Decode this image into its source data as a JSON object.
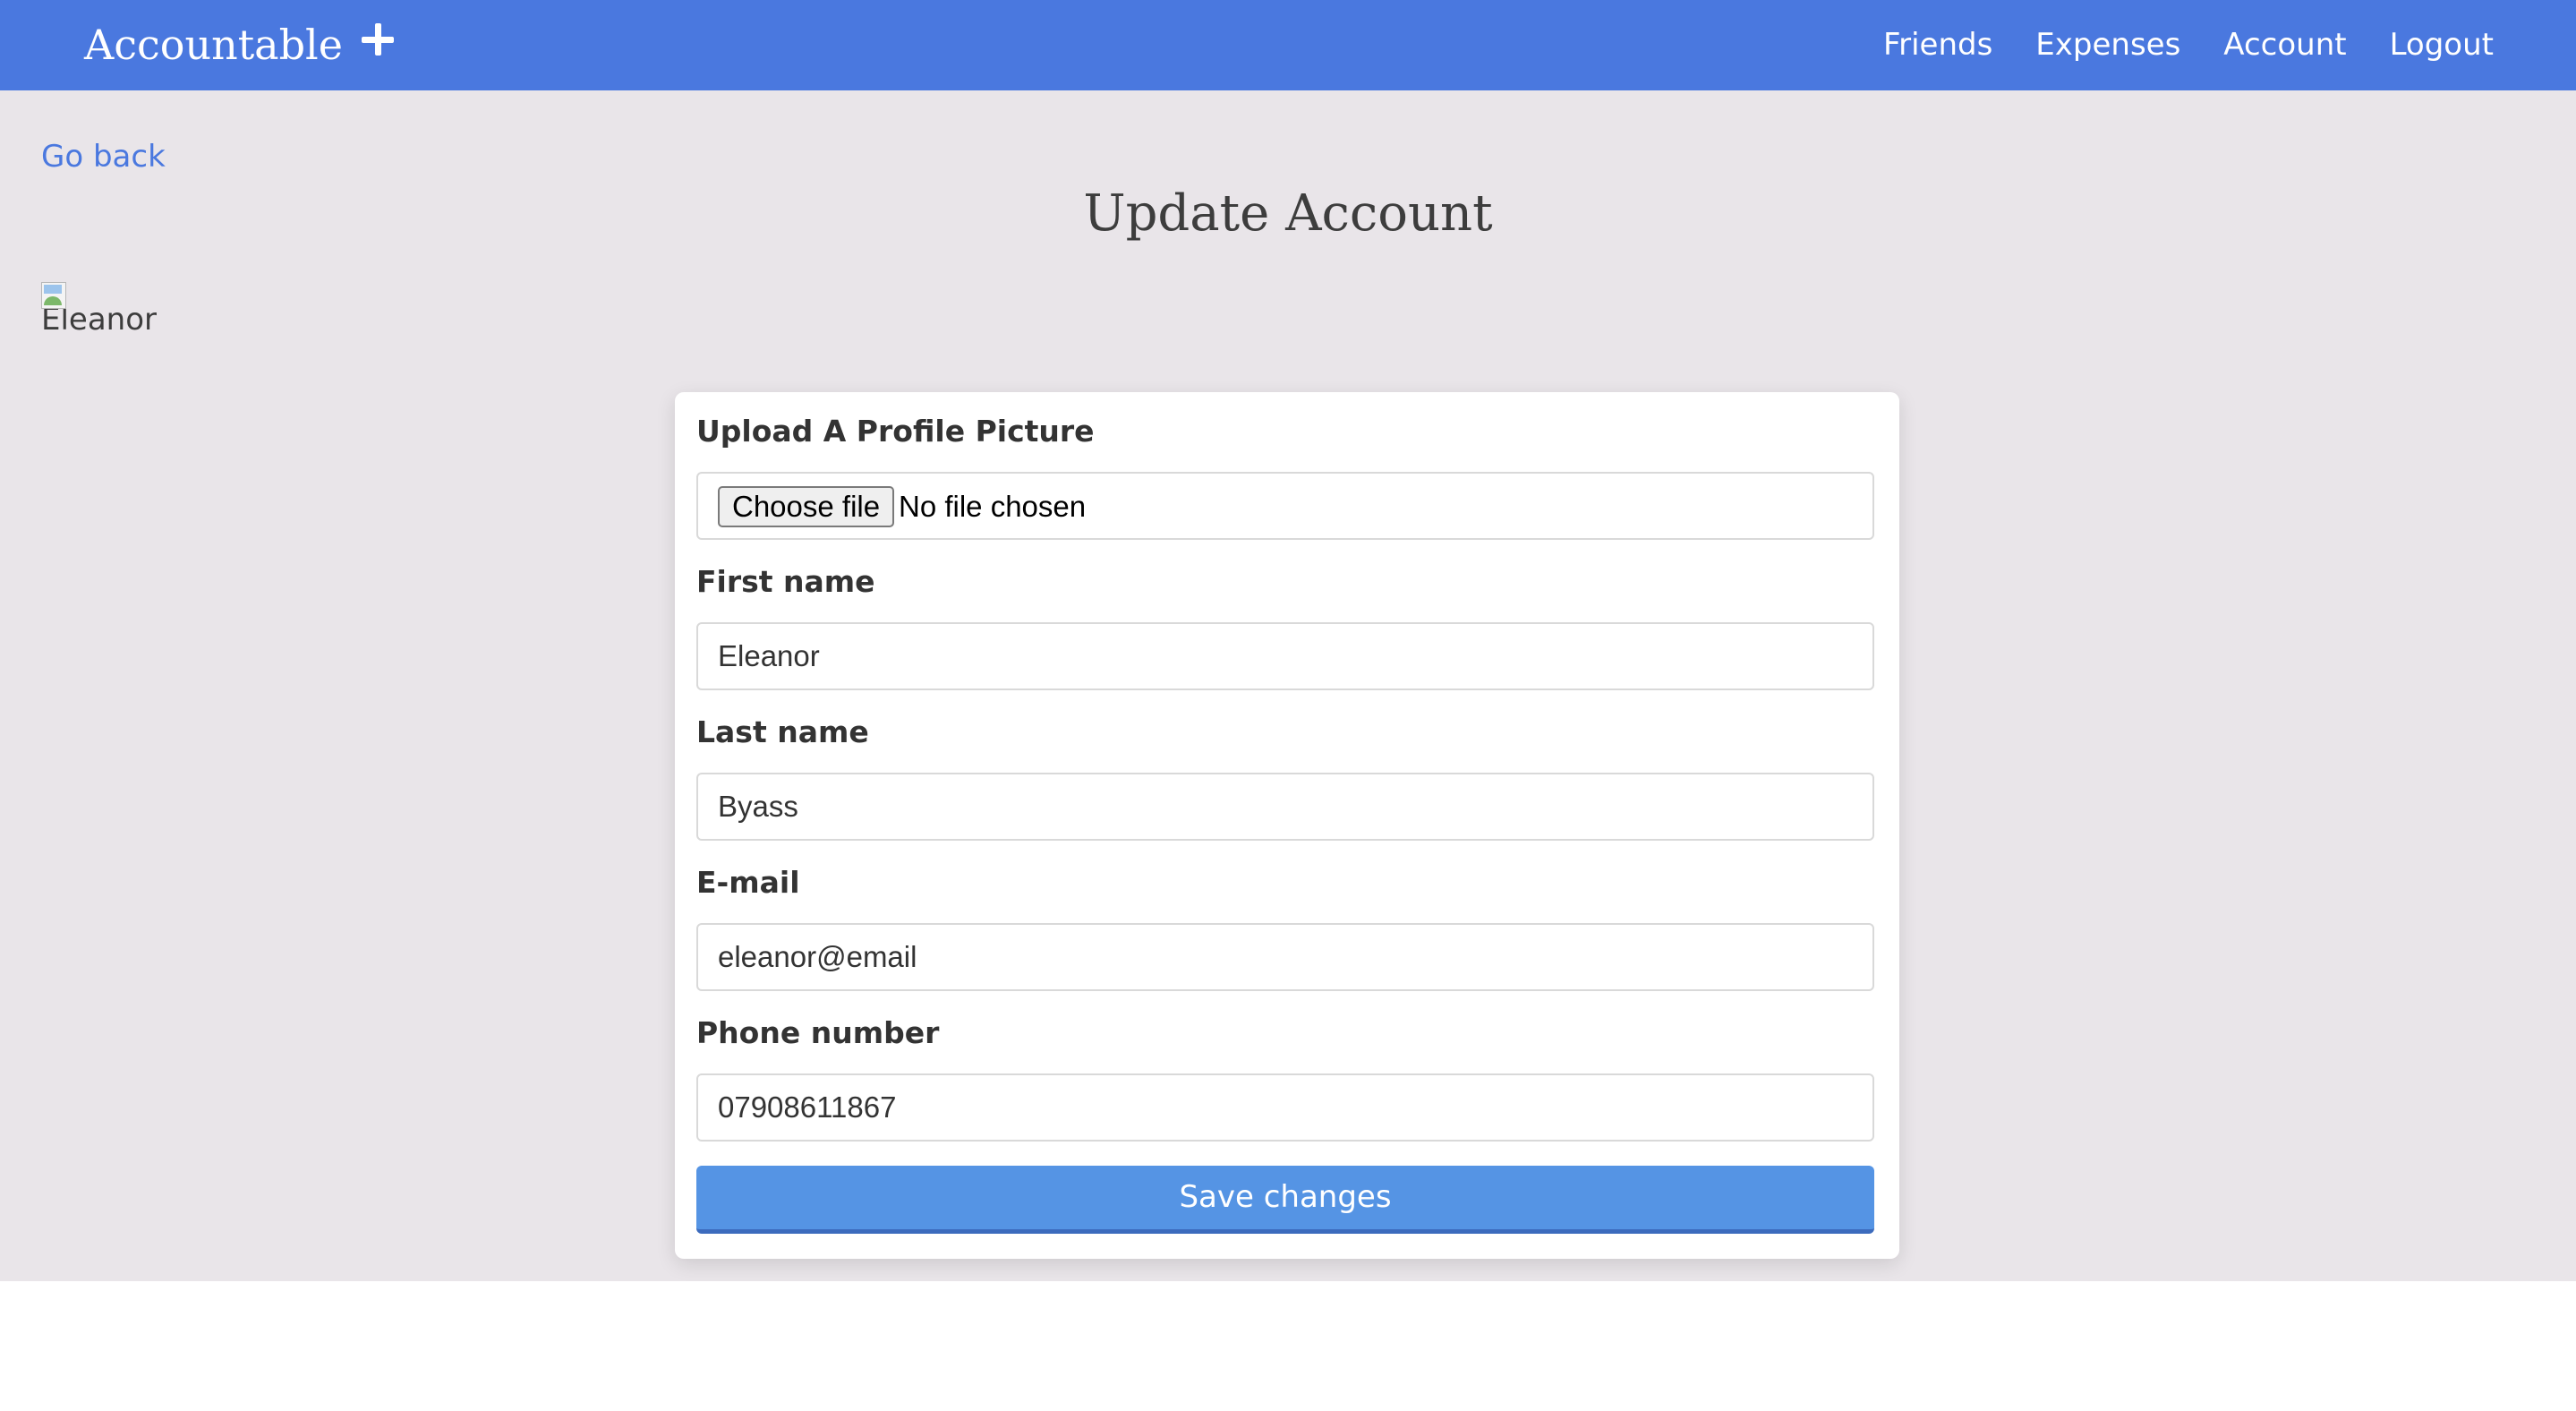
{
  "navbar": {
    "brand": "Accountable",
    "add_icon": "plus-icon",
    "links": [
      "Friends",
      "Expenses",
      "Account",
      "Logout"
    ],
    "color": "#4a78df"
  },
  "page": {
    "go_back": "Go back",
    "title": "Update Account",
    "profile_image_alt": "Eleanor",
    "background": "#e9e5e9"
  },
  "form": {
    "upload_label": "Upload A Profile Picture",
    "choose_file": "Choose file",
    "no_file": "No file chosen",
    "first_name_label": "First name",
    "first_name_value": "Eleanor",
    "last_name_label": "Last name",
    "last_name_value": "Byass",
    "email_label": "E-mail",
    "email_value": "eleanor@email",
    "phone_label": "Phone number",
    "phone_value": "07908611867",
    "save_label": "Save changes",
    "save_color": "#5594e4"
  }
}
